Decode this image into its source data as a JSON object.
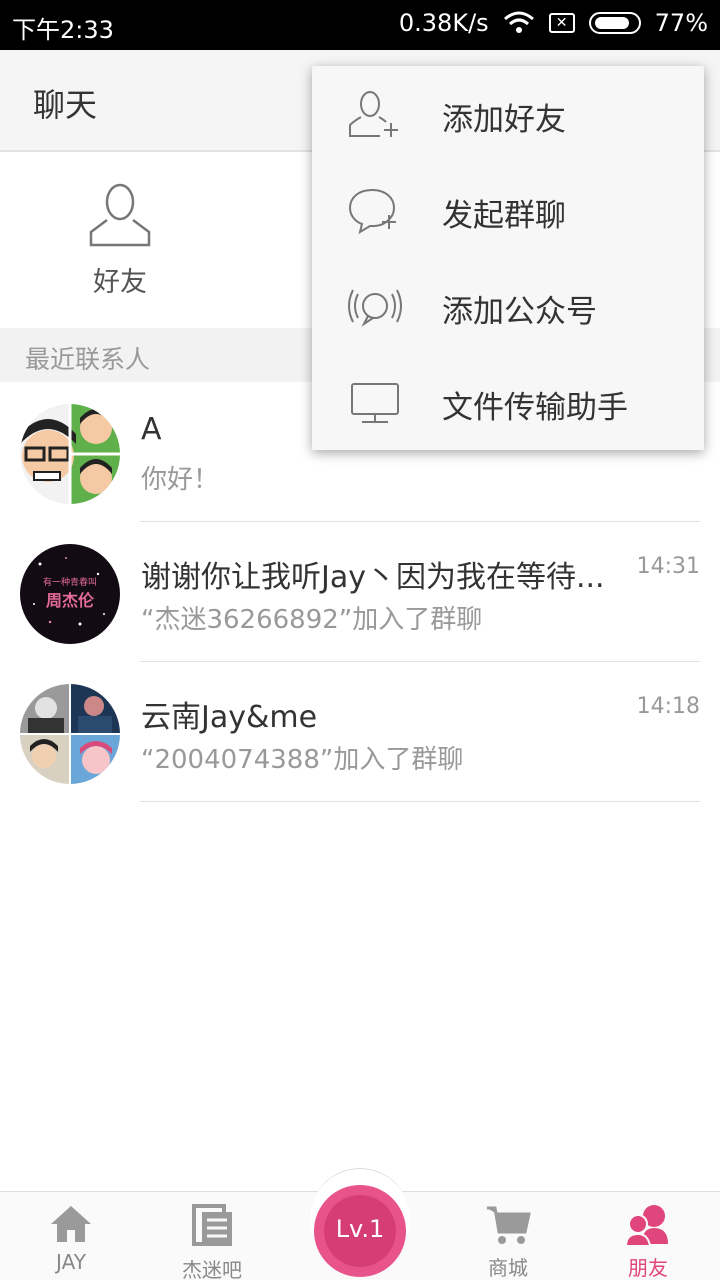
{
  "status_bar": {
    "time": "下午2:33",
    "speed": "0.38K/s",
    "battery": "77%"
  },
  "header": {
    "title": "聊天"
  },
  "quick_entry": {
    "friends_label": "好友"
  },
  "section": {
    "recent_label": "最近联系人"
  },
  "chats": [
    {
      "name": "A",
      "message": "你好！",
      "time": ""
    },
    {
      "name": "谢谢你让我听Jay丶因为我在等待...",
      "message": "“杰迷36266892”加入了群聊",
      "time": "14:31",
      "avatar_text": "有一种青春叫 周杰伦"
    },
    {
      "name": "云南Jay&me",
      "message": "“2004074388”加入了群聊",
      "time": "14:18"
    }
  ],
  "menu": [
    {
      "label": "添加好友",
      "icon": "add-friend-icon"
    },
    {
      "label": "发起群聊",
      "icon": "start-group-chat-icon"
    },
    {
      "label": "添加公众号",
      "icon": "add-official-account-icon"
    },
    {
      "label": "文件传输助手",
      "icon": "file-transfer-icon"
    }
  ],
  "bottom_nav": {
    "items": [
      {
        "label": "JAY",
        "icon": "home-icon"
      },
      {
        "label": "杰迷吧",
        "icon": "forum-icon"
      },
      {
        "label": "商城",
        "icon": "cart-icon"
      },
      {
        "label": "朋友",
        "icon": "friends-icon",
        "active": true
      }
    ],
    "level": "Lv.1"
  },
  "colors": {
    "accent": "#e0457b",
    "level_bg": "#e8538a"
  }
}
